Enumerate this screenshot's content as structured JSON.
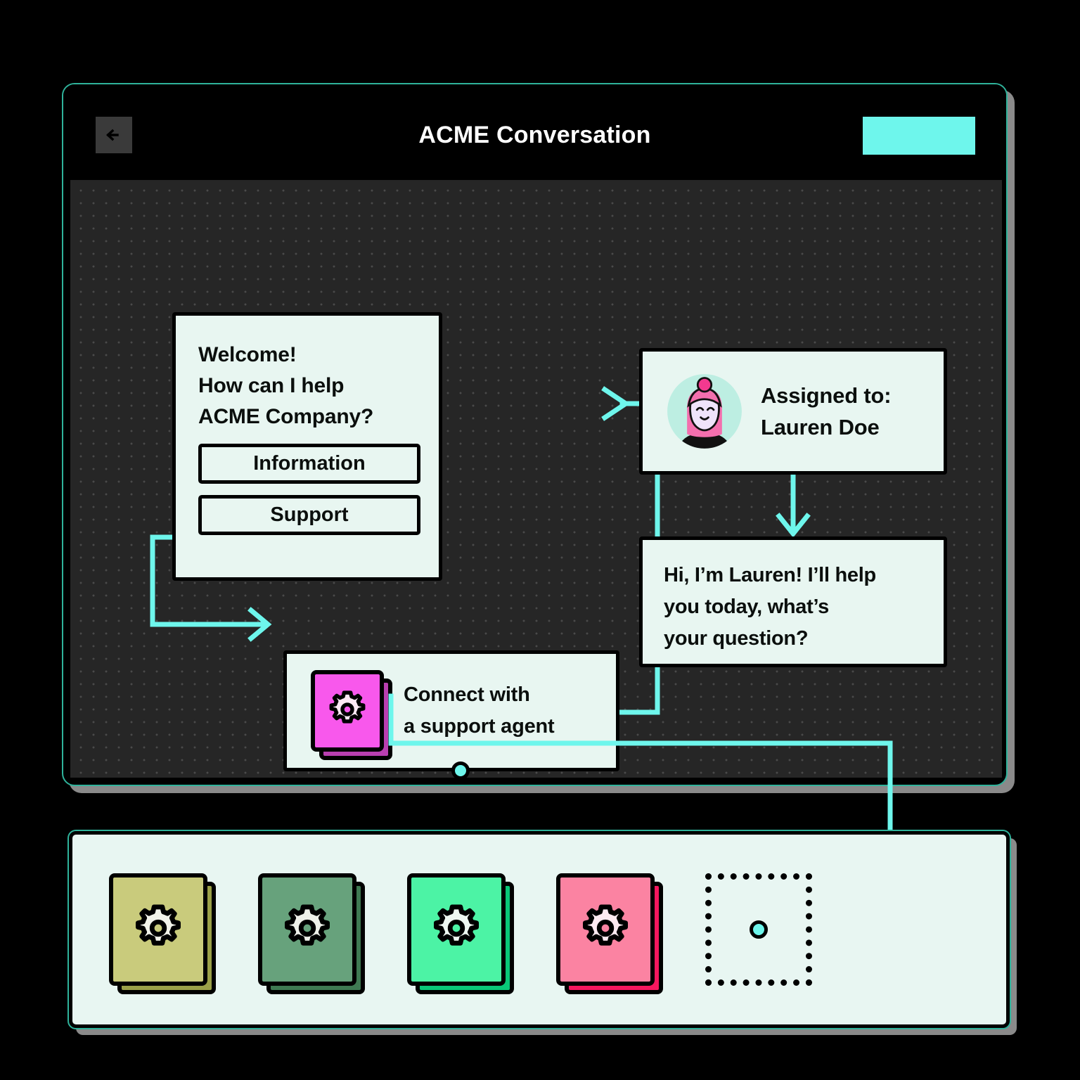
{
  "window": {
    "title": "ACME Conversation",
    "back_icon": "arrow-left-icon",
    "cta_label": "",
    "accent_color": "#6ef6ec",
    "canvas_bg": "#262626",
    "card_bg": "#e8f6f1"
  },
  "flow": {
    "welcome_card": {
      "lines": [
        "Welcome!",
        "How can I help",
        "ACME Company?"
      ],
      "buttons": [
        {
          "label": "Information"
        },
        {
          "label": "Support"
        }
      ]
    },
    "connect_card": {
      "icon": "gear-tile-icon",
      "icon_color": "#f858ec",
      "lines": [
        "Connect with",
        "a support agent"
      ]
    },
    "assigned_card": {
      "avatar": "agent-avatar-icon",
      "lines": [
        "Assigned to:",
        "Lauren Doe"
      ]
    },
    "reply_card": {
      "lines": [
        "Hi, I’m Lauren! I’ll help",
        "you today, what’s",
        "your question?"
      ]
    }
  },
  "palette": {
    "tiles": [
      {
        "name": "gear-tile-khaki",
        "color": "#c9cb7c",
        "shadow": "#9aa048"
      },
      {
        "name": "gear-tile-sage",
        "color": "#67a27c",
        "shadow": "#3f7a52"
      },
      {
        "name": "gear-tile-spring",
        "color": "#4cf3a5",
        "shadow": "#09c878"
      },
      {
        "name": "gear-tile-pink",
        "color": "#fb83a2",
        "shadow": "#f5175e"
      }
    ],
    "dropzone": {
      "label": ""
    }
  }
}
